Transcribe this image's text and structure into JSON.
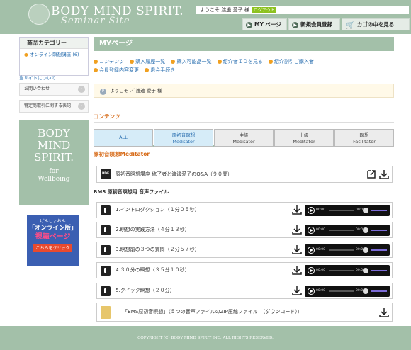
{
  "header": {
    "logo_main": "BODY MIND SPIRIT.",
    "logo_sub": "Seminar Site",
    "welcome_text": "ようこそ 渡邊 愛子 様",
    "logout_label": "ログアウト",
    "nav": {
      "mypage": "MY ページ",
      "register": "新規会員登録",
      "cart": "カゴの中を見る"
    }
  },
  "sidebar": {
    "category_title": "商品カテゴリー",
    "category_item": "オンライン瞑想講座 (6)",
    "about_link": "当サイトについて",
    "contact_button": "お問い合わせ",
    "legal_button": "特定商取引に関する表記",
    "banner": {
      "line1": "BODY",
      "line2": "MIND",
      "line3": "SPIRIT.",
      "line4": "for",
      "line5": "Wellbeing"
    },
    "online_banner": {
      "top": "げんしょおん",
      "mid": "「オンライン版」",
      "pink": "視聴ページ",
      "click": "こちらをクリック"
    }
  },
  "main": {
    "title": "MYページ",
    "links": [
      "コンテンツ",
      "購入履歴一覧",
      "購入可能品一覧",
      "紹介者ＩＤを見る",
      "紹介割引ご購入者",
      "会員登録内容変更",
      "退会手続き"
    ],
    "welcome_label": "ようこそ ／ 渡邊 愛子 様",
    "contents_label": "コンテンツ",
    "tabs": [
      {
        "line1": "ALL",
        "line2": ""
      },
      {
        "line1": "原初音瞑想",
        "line2": "Meditator"
      },
      {
        "line1": "中級",
        "line2": "Meditator"
      },
      {
        "line1": "上級",
        "line2": "Meditator"
      },
      {
        "line1": "瞑想",
        "line2": "Facilitator"
      }
    ],
    "section_title": "原初音瞑想Meditator",
    "pdf_label": "原初音瞑想講座 修了者と渡邊愛子のQ&A（９０問）",
    "audio_title": "BMS 原初音瞑想用 音声ファイル",
    "audio_items": [
      {
        "label": "1.イントロダクション（１分０５秒）",
        "time_start": "00:00",
        "time_end": "00:00"
      },
      {
        "label": "2.瞑想の実践方法（４分１３秒）",
        "time_start": "00:00",
        "time_end": "00:00"
      },
      {
        "label": "3.瞑想前の３つの質問（２分５７秒）",
        "time_start": "00:00",
        "time_end": "00:00"
      },
      {
        "label": "4.３０分の瞑想（３５分１０秒）",
        "time_start": "00:00",
        "time_end": "00:00"
      },
      {
        "label": "5.クイック瞑想（２０分）",
        "time_start": "00:00",
        "time_end": "00:00"
      }
    ],
    "zip_label": "「BMS原初音瞑想」（５つの音声ファイルのZIP圧縮ファイル　（ダウンロード））"
  },
  "footer": {
    "copyright": "COPYRIGHT (C) BODY MIND SPIRIT INC. ALL RIGHTS RESERVED."
  },
  "colors": {
    "brand": "#a3c0a9",
    "accent": "#d76c1a",
    "link": "#2a6fb0"
  }
}
